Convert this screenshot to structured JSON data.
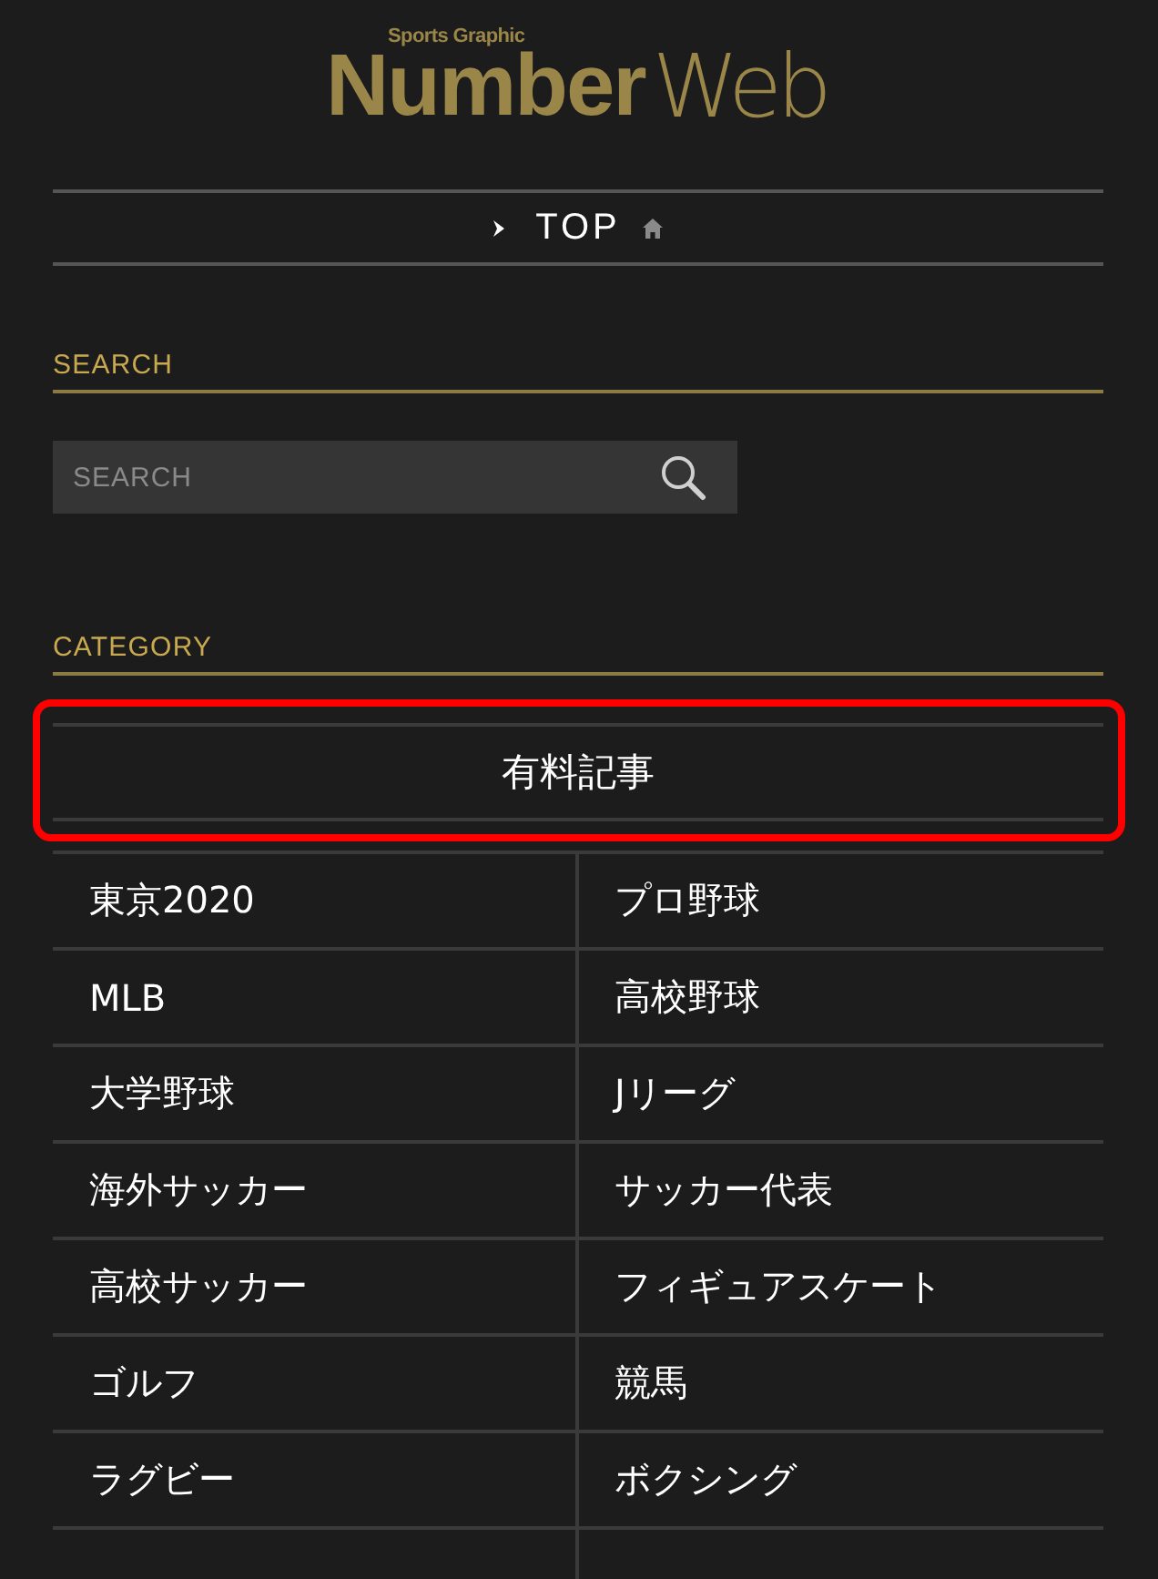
{
  "logo": {
    "tagline": "Sports Graphic",
    "name": "Number",
    "suffix": "Web"
  },
  "nav": {
    "label": "TOP"
  },
  "search": {
    "heading": "SEARCH",
    "placeholder": "SEARCH"
  },
  "category": {
    "heading": "CATEGORY",
    "featured": {
      "label": "有料記事",
      "highlighted": true
    },
    "items": [
      {
        "label": "東京2020"
      },
      {
        "label": "プロ野球"
      },
      {
        "label": "MLB"
      },
      {
        "label": "高校野球"
      },
      {
        "label": "大学野球"
      },
      {
        "label": "Jリーグ"
      },
      {
        "label": "海外サッカー"
      },
      {
        "label": "サッカー代表"
      },
      {
        "label": "高校サッカー"
      },
      {
        "label": "フィギュアスケート"
      },
      {
        "label": "ゴルフ"
      },
      {
        "label": "競馬"
      },
      {
        "label": "ラグビー"
      },
      {
        "label": "ボクシング"
      }
    ]
  }
}
